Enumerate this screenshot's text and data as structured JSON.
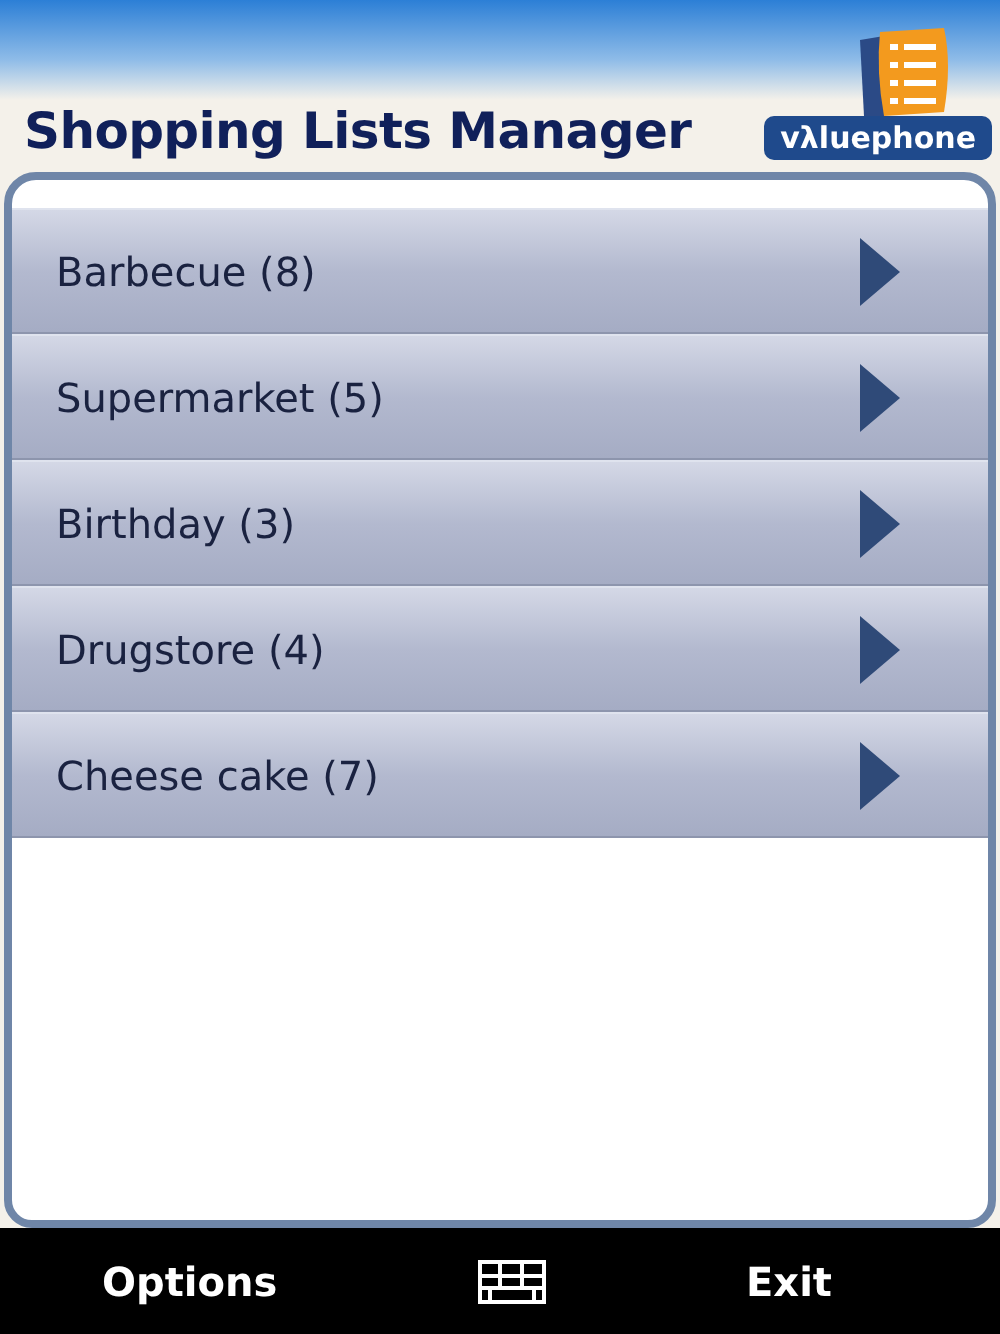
{
  "header": {
    "title": "Shopping Lists Manager",
    "logo_text": "vλluephone"
  },
  "lists": [
    {
      "label": "Barbecue (8)"
    },
    {
      "label": "Supermarket (5)"
    },
    {
      "label": "Birthday (3)"
    },
    {
      "label": "Drugstore (4)"
    },
    {
      "label": "Cheese cake (7)"
    }
  ],
  "softkeys": {
    "left": "Options",
    "right": "Exit"
  }
}
